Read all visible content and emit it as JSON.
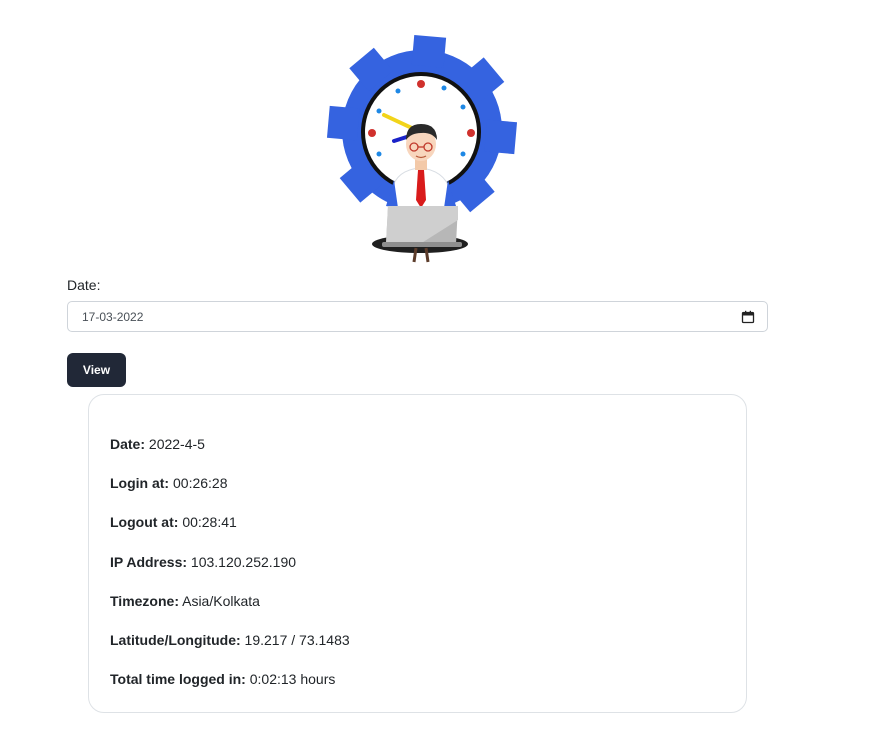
{
  "form": {
    "date_label": "Date:",
    "date_value": "17-03-2022",
    "view_label": "View"
  },
  "details": [
    {
      "label": "Date:",
      "value": "2022-4-5"
    },
    {
      "label": "Login at:",
      "value": "00:26:28"
    },
    {
      "label": "Logout at:",
      "value": "00:28:41"
    },
    {
      "label": "IP Address:",
      "value": "103.120.252.190"
    },
    {
      "label": "Timezone:",
      "value": "Asia/Kolkata"
    },
    {
      "label": "Latitude/Longitude:",
      "value": "19.217 / 73.1483"
    },
    {
      "label": "Total time logged in:",
      "value": "0:02:13 hours"
    }
  ],
  "icons": {
    "illustration": "person-with-laptop-clock-gear-illustration",
    "calendar": "calendar-icon"
  },
  "colors": {
    "button_bg": "#212837",
    "gear_blue": "#3563e0"
  }
}
